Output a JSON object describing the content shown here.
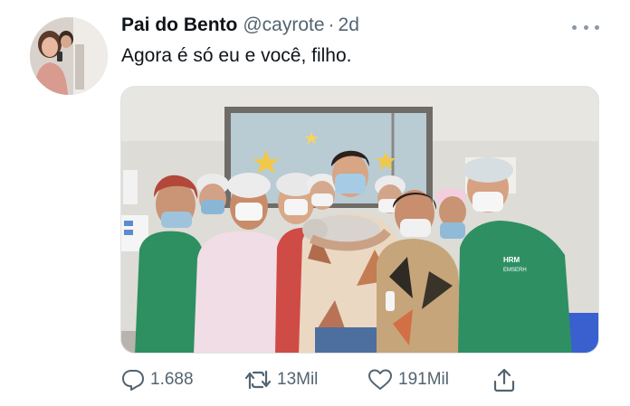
{
  "tweet": {
    "author": {
      "display_name": "Pai do Bento",
      "handle": "@cayrote",
      "separator": "·",
      "time": "2d"
    },
    "text": "Agora é só eu e você, filho.",
    "media": {
      "photo": "group-photo",
      "scrub_text_1": "HRM",
      "scrub_text_2": "EMSERH"
    },
    "actions": {
      "reply_icon": "reply-icon",
      "reply_count": "1.688",
      "retweet_icon": "retweet-icon",
      "retweet_count": "13Mil",
      "like_icon": "heart-icon",
      "like_count": "191Mil",
      "share_icon": "share-icon"
    },
    "more_icon": "more-icon"
  },
  "colors": {
    "text": "#0f1419",
    "secondary": "#536471",
    "background": "#ffffff"
  }
}
